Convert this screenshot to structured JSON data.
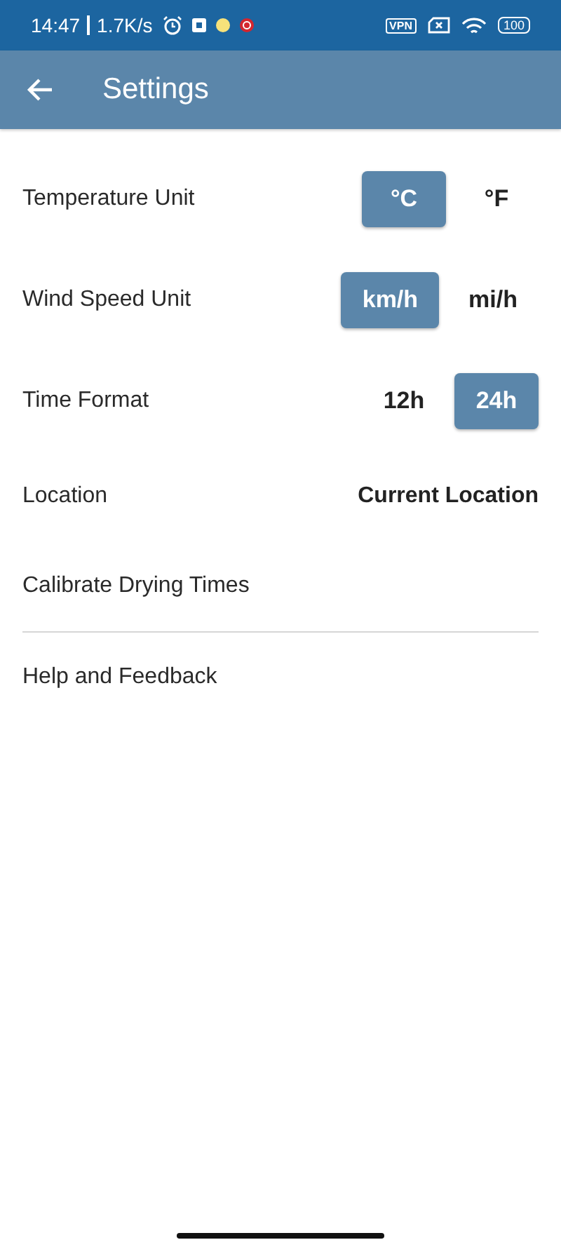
{
  "status_bar": {
    "time": "14:47",
    "speed": "1.7K/s",
    "vpn": "VPN",
    "battery": "100"
  },
  "app_bar": {
    "title": "Settings"
  },
  "groups": [
    {
      "items": [
        {
          "kind": "toggle",
          "label": "Temperature Unit",
          "options": [
            {
              "label": "°C",
              "selected": true
            },
            {
              "label": "°F",
              "selected": false
            }
          ]
        },
        {
          "kind": "toggle",
          "label": "Wind Speed Unit",
          "options": [
            {
              "label": "km/h",
              "selected": true
            },
            {
              "label": "mi/h",
              "selected": false
            }
          ]
        },
        {
          "kind": "toggle",
          "label": "Time Format",
          "options": [
            {
              "label": "12h",
              "selected": false
            },
            {
              "label": "24h",
              "selected": true
            }
          ]
        },
        {
          "kind": "value",
          "label": "Location",
          "value": "Current Location"
        },
        {
          "kind": "link",
          "label": "Calibrate Drying Times"
        }
      ]
    },
    {
      "items": [
        {
          "kind": "link",
          "label": "Help and Feedback"
        }
      ]
    }
  ]
}
